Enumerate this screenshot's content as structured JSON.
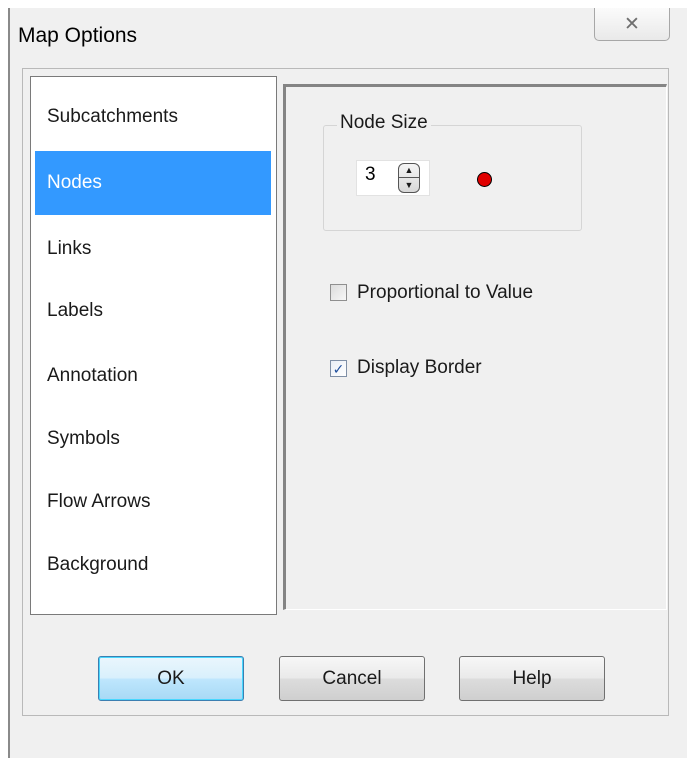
{
  "window": {
    "title": "Map Options",
    "close_label": "✕"
  },
  "sidebar": {
    "selected_index": 1,
    "items": [
      {
        "label": "Subcatchments"
      },
      {
        "label": "Nodes"
      },
      {
        "label": "Links"
      },
      {
        "label": "Labels"
      },
      {
        "label": "Annotation"
      },
      {
        "label": "Symbols"
      },
      {
        "label": "Flow Arrows"
      },
      {
        "label": "Background"
      }
    ]
  },
  "node_size": {
    "group_label": "Node Size",
    "value": "3",
    "preview_color": "#e00000"
  },
  "options": {
    "proportional": {
      "label": "Proportional to Value",
      "checked": false
    },
    "display_border": {
      "label": "Display Border",
      "checked": true
    }
  },
  "buttons": {
    "ok": "OK",
    "cancel": "Cancel",
    "help": "Help"
  },
  "colors": {
    "selection": "#3399ff",
    "dialog_bg": "#f0f0f0"
  }
}
